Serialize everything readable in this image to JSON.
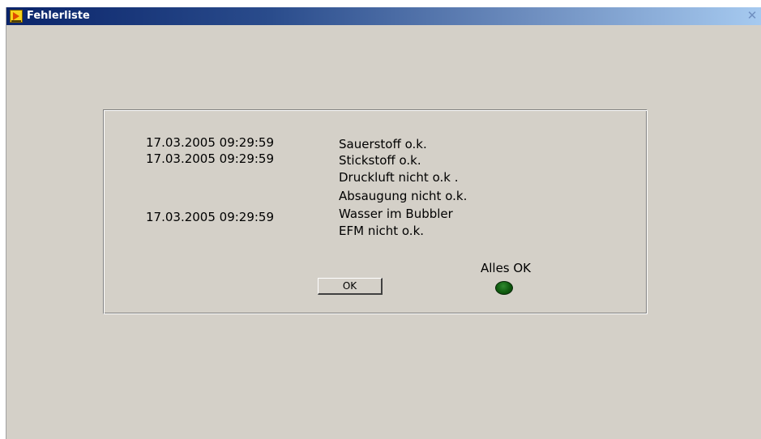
{
  "window": {
    "title": "Fehlerliste",
    "close_symbol": "✕"
  },
  "icons": {
    "app": "labview-vi-icon",
    "close": "close-icon"
  },
  "messages": [
    {
      "timestamp": "17.03.2005 09:29:59",
      "text": "Sauerstoff o.k."
    },
    {
      "timestamp": "17.03.2005 09:29:59",
      "text": "Stickstoff o.k."
    },
    {
      "timestamp": "",
      "text": "Druckluft nicht o.k ."
    },
    {
      "timestamp": "",
      "text": "Absaugung nicht o.k."
    },
    {
      "timestamp": "17.03.2005 09:29:59",
      "text": "Wasser im Bubbler"
    },
    {
      "timestamp": "",
      "text": "EFM nicht o.k."
    }
  ],
  "ok_button": {
    "label": "OK"
  },
  "status_led": {
    "label": "Alles OK",
    "state": "off",
    "color": "#0f5a0f"
  },
  "colors": {
    "window_bg": "#d4d0c8",
    "title_start": "#0a246a",
    "title_end": "#a6caf0"
  }
}
